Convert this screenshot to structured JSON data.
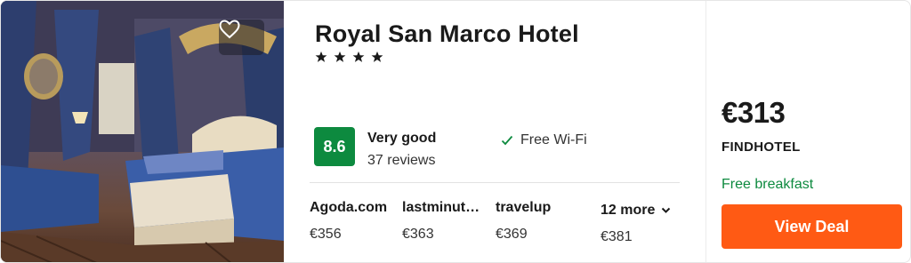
{
  "hotel": {
    "name": "Royal San Marco Hotel",
    "stars": "★ ★ ★ ★",
    "star_count": 4
  },
  "rating": {
    "score": "8.6",
    "label": "Very good",
    "reviews": "37 reviews"
  },
  "amenity": {
    "icon": "check-icon",
    "label": "Free Wi-Fi"
  },
  "providers": [
    {
      "name": "Agoda.com",
      "price": "€356"
    },
    {
      "name": "lastminut…",
      "price": "€363"
    },
    {
      "name": "travelup",
      "price": "€369"
    }
  ],
  "more_providers": {
    "label": "12 more",
    "price": "€381"
  },
  "deal": {
    "price": "€313",
    "provider": "FINDHOTEL",
    "perk": "Free breakfast",
    "button_label": "View Deal"
  },
  "colors": {
    "rating_badge": "#0d8a3f",
    "perk_text": "#0d8a3f",
    "deal_button": "#ff5a14"
  },
  "icons": {
    "favorite": "heart-icon",
    "amenity": "check-icon",
    "expand": "chevron-down-icon"
  }
}
